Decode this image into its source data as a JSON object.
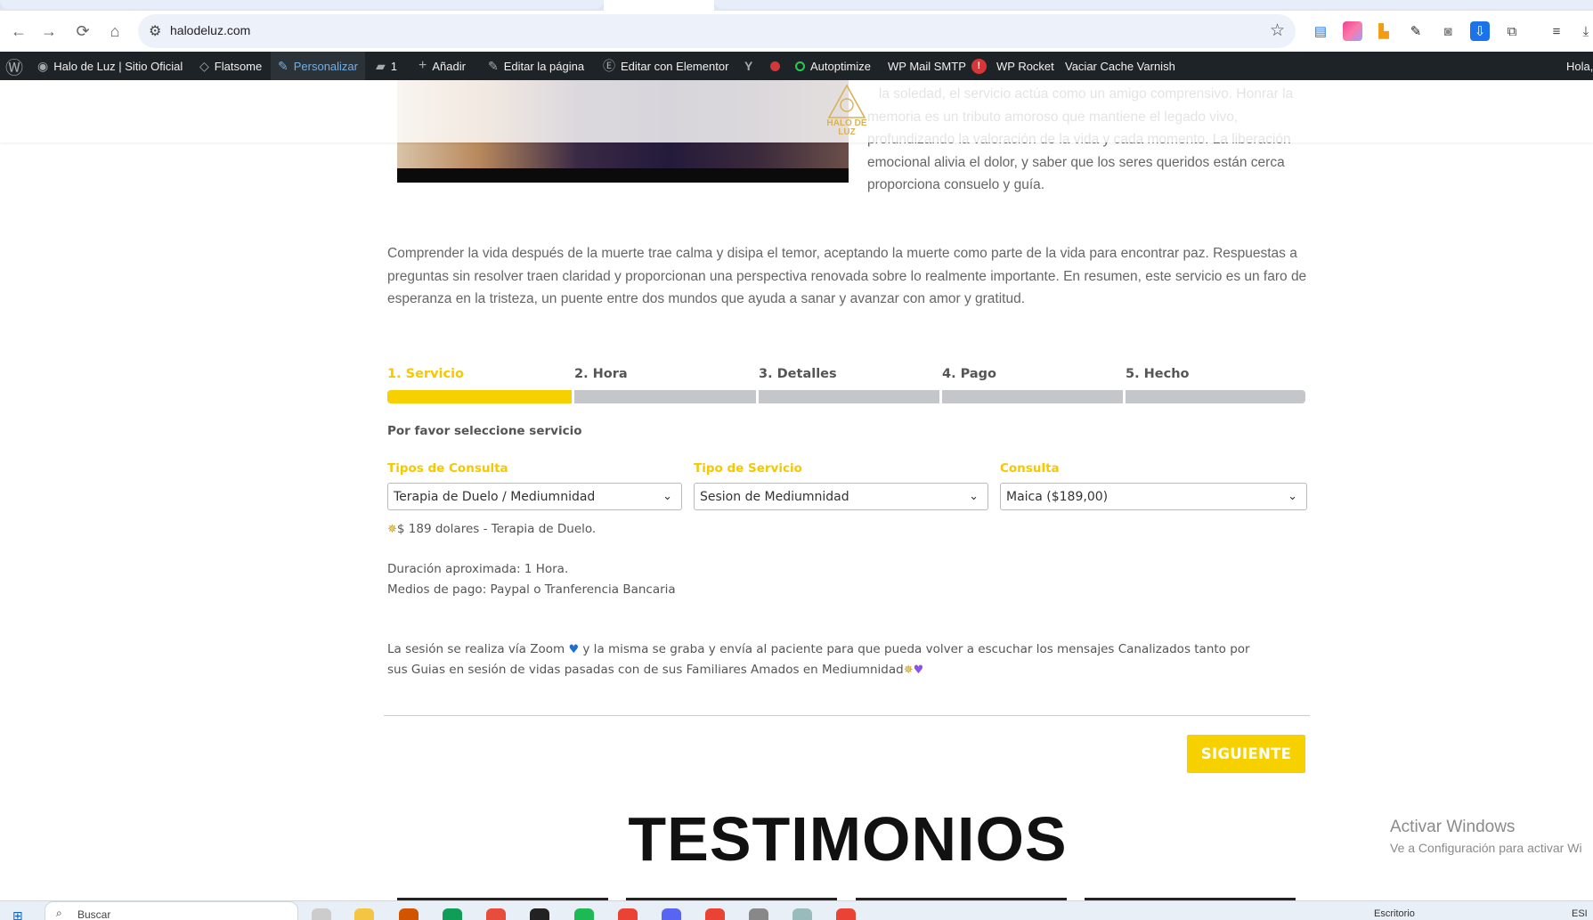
{
  "browser": {
    "url": "halodeluz.com",
    "icons": {
      "back": "←",
      "forward": "→",
      "reload": "⟳",
      "home": "⌂",
      "site_info": "⚙",
      "star": "☆"
    }
  },
  "admin_bar": {
    "site_name": "Halo de Luz | Sitio Oficial",
    "flatsome": "Flatsome",
    "personalize": "Personalizar",
    "comments_count": "1",
    "add_new": "Añadir",
    "edit_page": "Editar la página",
    "edit_elementor": "Editar con Elementor",
    "autoptimize": "Autoptimize",
    "wp_mail_smtp": "WP Mail SMTP",
    "wp_mail_badge": "!",
    "wp_rocket": "WP Rocket",
    "varnish": "Vaciar Cache Varnish",
    "greeting": "Hola,"
  },
  "logo": {
    "line1": "HALO DE",
    "line2": "LUZ"
  },
  "right_paragraph": "   la soledad, el servicio actúa como un amigo comprensivo. Honrar la memoria es un tributo amoroso que mantiene el legado vivo, profundizando la valoración de la vida y cada momento. La liberación emocional alivia el dolor, y saber que los seres queridos están cerca proporciona consuelo y guía.",
  "middle_paragraph": "Comprender la vida después de la muerte trae calma y disipa el temor, aceptando la muerte como parte de la vida para encontrar paz. Respuestas a preguntas sin resolver traen claridad y proporcionan una perspectiva renovada sobre lo realmente importante. En resumen, este servicio es un faro de esperanza en la tristeza, un puente entre dos mundos que ayuda a sanar y avanzar con amor y gratitud.",
  "steps": [
    {
      "label": "1. Servicio",
      "active": true
    },
    {
      "label": "2. Hora",
      "active": false
    },
    {
      "label": "3. Detalles",
      "active": false
    },
    {
      "label": "4. Pago",
      "active": false
    },
    {
      "label": "5. Hecho",
      "active": false
    }
  ],
  "booking": {
    "title": "Por favor seleccione servicio",
    "consulta_type_label": "Tipos de Consulta",
    "consulta_type_value": "Terapia de Duelo / Mediumnidad",
    "service_type_label": "Tipo de Servicio",
    "service_type_value": "Sesion de Mediumnidad",
    "consulta_label": "Consulta",
    "consulta_value": "Maica ($189,00)",
    "price_line": "$ 189 dolares - Terapia de Duelo.",
    "duration_line": "Duración aproximada: 1 Hora.",
    "payment_line": "Medios de pago: Paypal o Tranferencia Bancaria",
    "session_line_1a": "La sesión se realiza vía Zoom",
    "session_line_1b": "y la misma se graba y envía al paciente para que pueda volver a escuchar los mensajes Canalizados tanto por",
    "session_line_2": "sus Guias en sesión de vidas pasadas con de sus Familiares Amados en Mediumnidad",
    "next_label": "SIGUIENTE"
  },
  "testimonials_heading": "TESTIMONIOS",
  "windows_watermark": {
    "line1": "Activar Windows",
    "line2": "Ve a Configuración para activar Wi"
  },
  "taskbar": {
    "search_placeholder": "Buscar",
    "desktop_label": "Escritorio",
    "lang": "ESI"
  },
  "colors": {
    "accent_yellow": "#f7d000",
    "admin_bar": "#1d2327",
    "inactive_step": "#c4c6c9"
  }
}
